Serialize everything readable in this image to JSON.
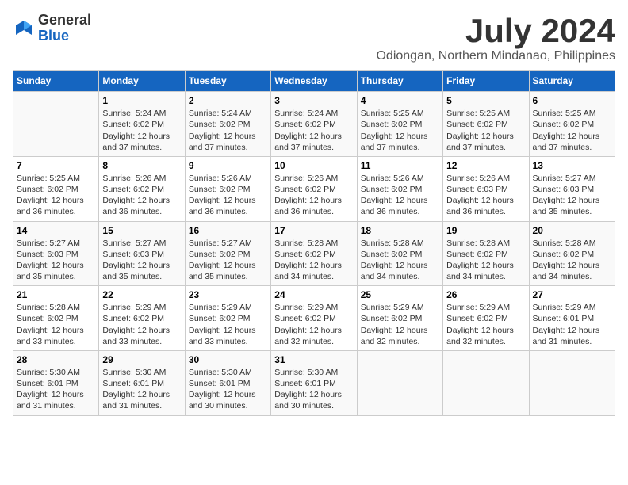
{
  "logo": {
    "general": "General",
    "blue": "Blue"
  },
  "title": "July 2024",
  "subtitle": "Odiongan, Northern Mindanao, Philippines",
  "days_of_week": [
    "Sunday",
    "Monday",
    "Tuesday",
    "Wednesday",
    "Thursday",
    "Friday",
    "Saturday"
  ],
  "weeks": [
    [
      {
        "day": "",
        "content": ""
      },
      {
        "day": "1",
        "content": "Sunrise: 5:24 AM\nSunset: 6:02 PM\nDaylight: 12 hours\nand 37 minutes."
      },
      {
        "day": "2",
        "content": "Sunrise: 5:24 AM\nSunset: 6:02 PM\nDaylight: 12 hours\nand 37 minutes."
      },
      {
        "day": "3",
        "content": "Sunrise: 5:24 AM\nSunset: 6:02 PM\nDaylight: 12 hours\nand 37 minutes."
      },
      {
        "day": "4",
        "content": "Sunrise: 5:25 AM\nSunset: 6:02 PM\nDaylight: 12 hours\nand 37 minutes."
      },
      {
        "day": "5",
        "content": "Sunrise: 5:25 AM\nSunset: 6:02 PM\nDaylight: 12 hours\nand 37 minutes."
      },
      {
        "day": "6",
        "content": "Sunrise: 5:25 AM\nSunset: 6:02 PM\nDaylight: 12 hours\nand 37 minutes."
      }
    ],
    [
      {
        "day": "7",
        "content": "Sunrise: 5:25 AM\nSunset: 6:02 PM\nDaylight: 12 hours\nand 36 minutes."
      },
      {
        "day": "8",
        "content": "Sunrise: 5:26 AM\nSunset: 6:02 PM\nDaylight: 12 hours\nand 36 minutes."
      },
      {
        "day": "9",
        "content": "Sunrise: 5:26 AM\nSunset: 6:02 PM\nDaylight: 12 hours\nand 36 minutes."
      },
      {
        "day": "10",
        "content": "Sunrise: 5:26 AM\nSunset: 6:02 PM\nDaylight: 12 hours\nand 36 minutes."
      },
      {
        "day": "11",
        "content": "Sunrise: 5:26 AM\nSunset: 6:02 PM\nDaylight: 12 hours\nand 36 minutes."
      },
      {
        "day": "12",
        "content": "Sunrise: 5:26 AM\nSunset: 6:03 PM\nDaylight: 12 hours\nand 36 minutes."
      },
      {
        "day": "13",
        "content": "Sunrise: 5:27 AM\nSunset: 6:03 PM\nDaylight: 12 hours\nand 35 minutes."
      }
    ],
    [
      {
        "day": "14",
        "content": "Sunrise: 5:27 AM\nSunset: 6:03 PM\nDaylight: 12 hours\nand 35 minutes."
      },
      {
        "day": "15",
        "content": "Sunrise: 5:27 AM\nSunset: 6:03 PM\nDaylight: 12 hours\nand 35 minutes."
      },
      {
        "day": "16",
        "content": "Sunrise: 5:27 AM\nSunset: 6:02 PM\nDaylight: 12 hours\nand 35 minutes."
      },
      {
        "day": "17",
        "content": "Sunrise: 5:28 AM\nSunset: 6:02 PM\nDaylight: 12 hours\nand 34 minutes."
      },
      {
        "day": "18",
        "content": "Sunrise: 5:28 AM\nSunset: 6:02 PM\nDaylight: 12 hours\nand 34 minutes."
      },
      {
        "day": "19",
        "content": "Sunrise: 5:28 AM\nSunset: 6:02 PM\nDaylight: 12 hours\nand 34 minutes."
      },
      {
        "day": "20",
        "content": "Sunrise: 5:28 AM\nSunset: 6:02 PM\nDaylight: 12 hours\nand 34 minutes."
      }
    ],
    [
      {
        "day": "21",
        "content": "Sunrise: 5:28 AM\nSunset: 6:02 PM\nDaylight: 12 hours\nand 33 minutes."
      },
      {
        "day": "22",
        "content": "Sunrise: 5:29 AM\nSunset: 6:02 PM\nDaylight: 12 hours\nand 33 minutes."
      },
      {
        "day": "23",
        "content": "Sunrise: 5:29 AM\nSunset: 6:02 PM\nDaylight: 12 hours\nand 33 minutes."
      },
      {
        "day": "24",
        "content": "Sunrise: 5:29 AM\nSunset: 6:02 PM\nDaylight: 12 hours\nand 32 minutes."
      },
      {
        "day": "25",
        "content": "Sunrise: 5:29 AM\nSunset: 6:02 PM\nDaylight: 12 hours\nand 32 minutes."
      },
      {
        "day": "26",
        "content": "Sunrise: 5:29 AM\nSunset: 6:02 PM\nDaylight: 12 hours\nand 32 minutes."
      },
      {
        "day": "27",
        "content": "Sunrise: 5:29 AM\nSunset: 6:01 PM\nDaylight: 12 hours\nand 31 minutes."
      }
    ],
    [
      {
        "day": "28",
        "content": "Sunrise: 5:30 AM\nSunset: 6:01 PM\nDaylight: 12 hours\nand 31 minutes."
      },
      {
        "day": "29",
        "content": "Sunrise: 5:30 AM\nSunset: 6:01 PM\nDaylight: 12 hours\nand 31 minutes."
      },
      {
        "day": "30",
        "content": "Sunrise: 5:30 AM\nSunset: 6:01 PM\nDaylight: 12 hours\nand 30 minutes."
      },
      {
        "day": "31",
        "content": "Sunrise: 5:30 AM\nSunset: 6:01 PM\nDaylight: 12 hours\nand 30 minutes."
      },
      {
        "day": "",
        "content": ""
      },
      {
        "day": "",
        "content": ""
      },
      {
        "day": "",
        "content": ""
      }
    ]
  ]
}
